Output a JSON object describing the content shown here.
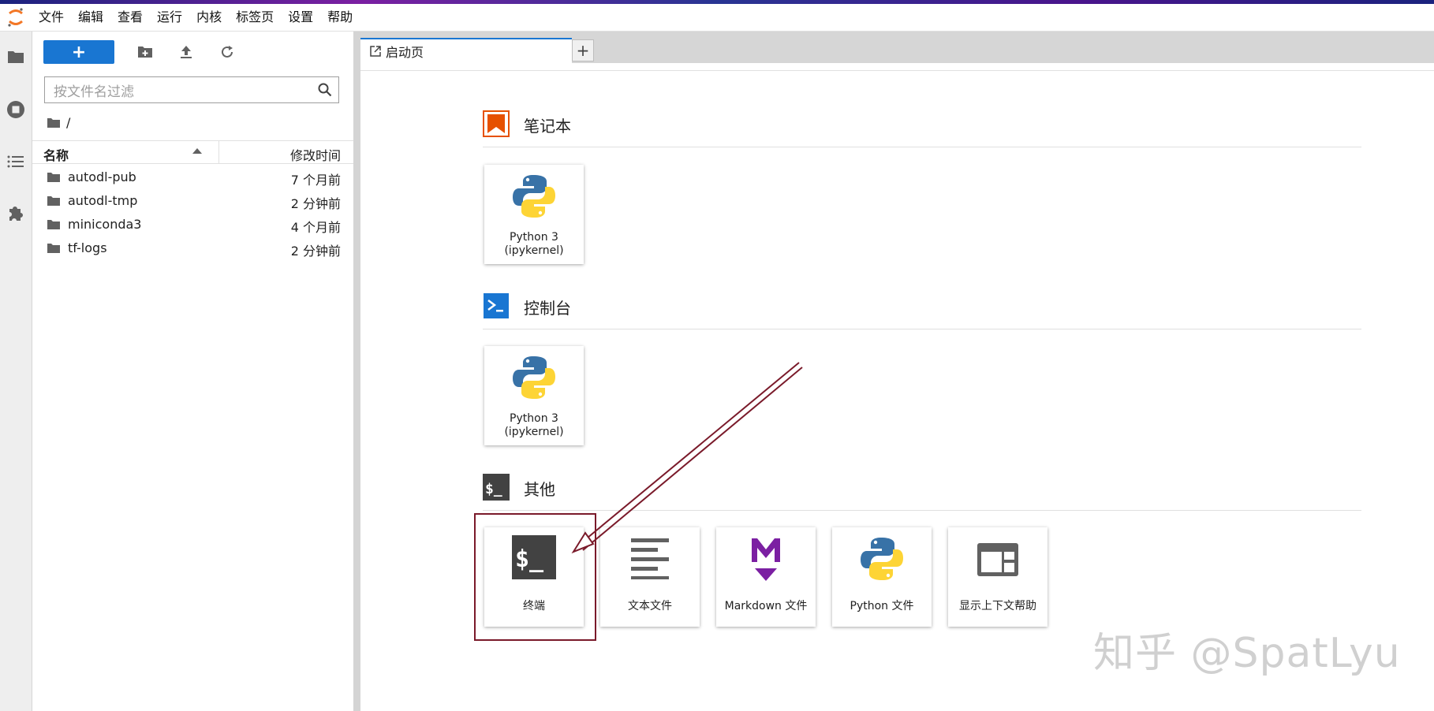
{
  "menu": [
    "文件",
    "编辑",
    "查看",
    "运行",
    "内核",
    "标签页",
    "设置",
    "帮助"
  ],
  "sidebar_icons": [
    "folder-icon",
    "running-icon",
    "toc-icon",
    "extension-icon"
  ],
  "filebrowser": {
    "new_label": "+",
    "search_placeholder": "按文件名过滤",
    "breadcrumb": "/",
    "col_name": "名称",
    "col_modified": "修改时间",
    "files": [
      {
        "name": "autodl-pub",
        "modified": "7 个月前"
      },
      {
        "name": "autodl-tmp",
        "modified": "2 分钟前"
      },
      {
        "name": "miniconda3",
        "modified": "4 个月前"
      },
      {
        "name": "tf-logs",
        "modified": "2 分钟前"
      }
    ]
  },
  "tab": {
    "title": "启动页",
    "add": "+"
  },
  "launcher": {
    "notebook": {
      "title": "笔记本",
      "cards": [
        {
          "line1": "Python 3",
          "line2": "(ipykernel)"
        }
      ]
    },
    "console": {
      "title": "控制台",
      "cards": [
        {
          "line1": "Python 3",
          "line2": "(ipykernel)"
        }
      ]
    },
    "other": {
      "title": "其他",
      "cards": [
        {
          "label": "终端",
          "icon": "terminal-icon"
        },
        {
          "label": "文本文件",
          "icon": "text-file-icon"
        },
        {
          "label": "Markdown 文件",
          "icon": "markdown-icon"
        },
        {
          "label": "Python 文件",
          "icon": "python-icon"
        },
        {
          "label": "显示上下文帮助",
          "icon": "context-help-icon"
        }
      ]
    }
  },
  "watermark": "知乎 @SpatLyu",
  "colors": {
    "accent": "#1976d2",
    "notebook": "#e65100",
    "annotation": "#7a1a2a"
  }
}
